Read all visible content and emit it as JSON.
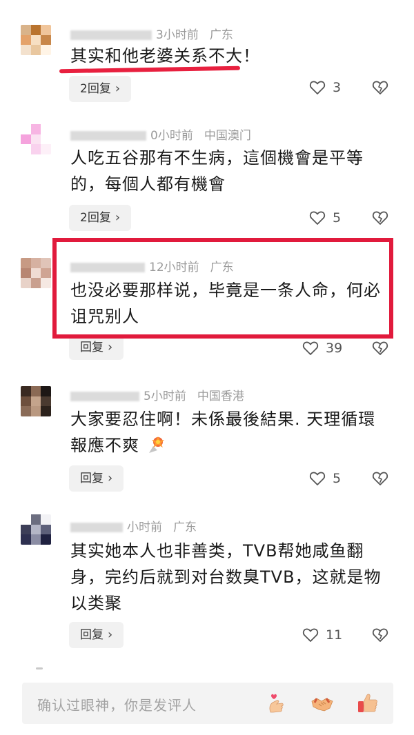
{
  "comments": [
    {
      "time": "3小时前",
      "location": "广东",
      "text": "其实和他老婆关系不大！",
      "reply_label": "2回复",
      "likes": "3"
    },
    {
      "time": "0小时前",
      "location": "中国澳门",
      "text": "人吃五谷那有不生病，這個機會是平等的，每個人都有機會",
      "reply_label": "2回复",
      "likes": "5"
    },
    {
      "time": "12小时前",
      "location": "广东",
      "text": "也没必要那样说，毕竟是一条人命，何必诅咒别人",
      "reply_label": "回复",
      "likes": "39"
    },
    {
      "time": "5小时前",
      "location": "中国香港",
      "text": "大家要忍住啊！未係最後結果. 天理循環報應不爽",
      "reply_label": "回复",
      "likes": "5"
    },
    {
      "time": "小时前",
      "location": "广东",
      "text": "其实她本人也非善类，TVB帮她咸鱼翻身，完约后就到对台数臭TVB，这就是物以类聚",
      "reply_label": "回复",
      "likes": "11"
    }
  ],
  "input": {
    "placeholder": "确认过眼神，你是发评人"
  },
  "colors": {
    "highlight": "#e11a3c",
    "underline": "#e8203f"
  }
}
